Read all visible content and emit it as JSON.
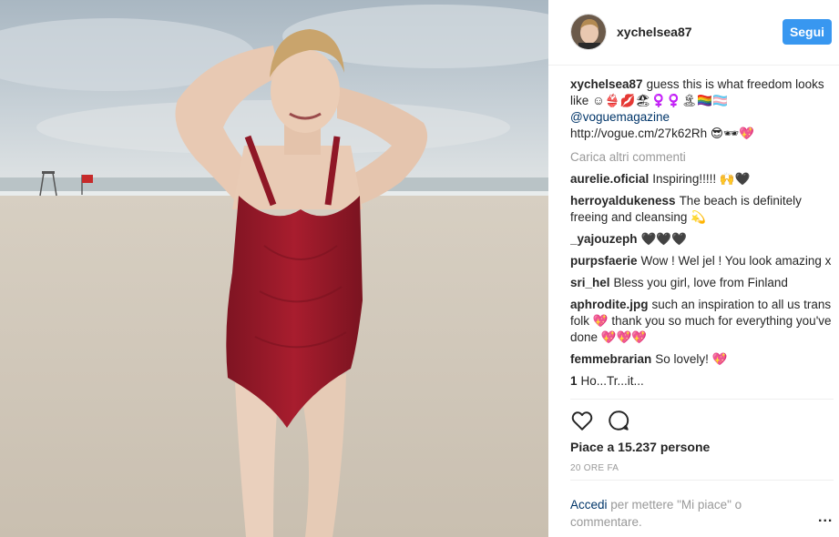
{
  "header": {
    "username": "xychelsea87",
    "follow_label": "Segui"
  },
  "caption": {
    "username": "xychelsea87",
    "text": "guess this is what freedom looks like ☺👙💋🏖♀️♀️🏝🏳️‍🌈🏳️‍⚧️",
    "mention": "@voguemagazine",
    "link": "http://vogue.cm/27k62Rh",
    "emoji_after_link": "😎🕶💖"
  },
  "load_more_label": "Carica altri commenti",
  "comments": [
    {
      "username": "aurelie.oficial",
      "text": "Inspiring!!!!! 🙌🖤"
    },
    {
      "username": "herroyaldukeness",
      "text": "The beach is definitely freeing and cleansing 💫"
    },
    {
      "username": "_yajouzeph",
      "text": "🖤🖤🖤"
    },
    {
      "username": "purpsfaerie",
      "text": "Wow ! Wel jel ! You look amazing x"
    },
    {
      "username": "sri_hel",
      "text": "Bless you girl, love from Finland"
    },
    {
      "username": "aphrodite.jpg",
      "text": "such an inspiration to all us trans folk 💖 thank you so much for everything you've done 💖💖💖"
    },
    {
      "username": "femmebrarian",
      "text": "So lovely! 💖"
    },
    {
      "username": "1",
      "text": "Ho...Tr...it..."
    }
  ],
  "actions": {
    "like_icon": "heart-icon",
    "comment_icon": "comment-bubble-icon"
  },
  "likes_text": "Piace a 15.237 persone",
  "timestamp": "20 ORE FA",
  "login_prompt": {
    "link_text": "Accedi",
    "rest_text": "per mettere \"Mi piace\" o commentare."
  },
  "more_label": "...",
  "colors": {
    "follow_button": "#3897f0",
    "link": "#003569",
    "muted": "#999999",
    "swimsuit": "#9e1b2a"
  }
}
